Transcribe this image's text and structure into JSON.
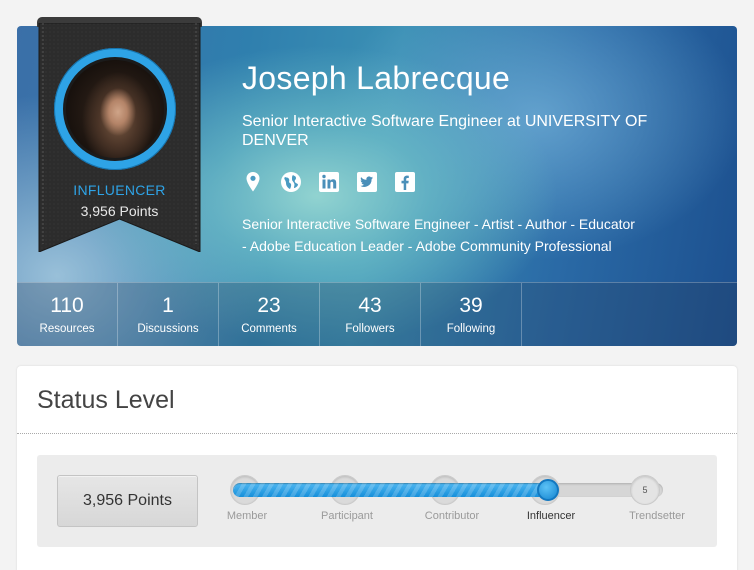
{
  "profile": {
    "name": "Joseph Labrecque",
    "title": "Senior Interactive Software Engineer at UNIVERSITY OF DENVER",
    "bio": "Senior Interactive Software Engineer - Artist - Author - Educator - Adobe Education Leader - Adobe Community Professional",
    "level": "INFLUENCER",
    "points": "3,956 Points",
    "social_icons": [
      "location-icon",
      "globe-icon",
      "linkedin-icon",
      "twitter-icon",
      "facebook-icon"
    ]
  },
  "stats": [
    {
      "value": "110",
      "label": "Resources"
    },
    {
      "value": "1",
      "label": "Discussions"
    },
    {
      "value": "23",
      "label": "Comments"
    },
    {
      "value": "43",
      "label": "Followers"
    },
    {
      "value": "39",
      "label": "Following"
    }
  ],
  "status": {
    "title": "Status Level",
    "points": "3,956 Points",
    "levels": [
      "Member",
      "Participant",
      "Contributor",
      "Influencer",
      "Trendsetter"
    ],
    "current_level": "Influencer",
    "next_level_number": "5",
    "progress_fraction": 0.74
  },
  "colors": {
    "accent": "#2ea3e6",
    "ribbon": "#2d2d2d"
  }
}
